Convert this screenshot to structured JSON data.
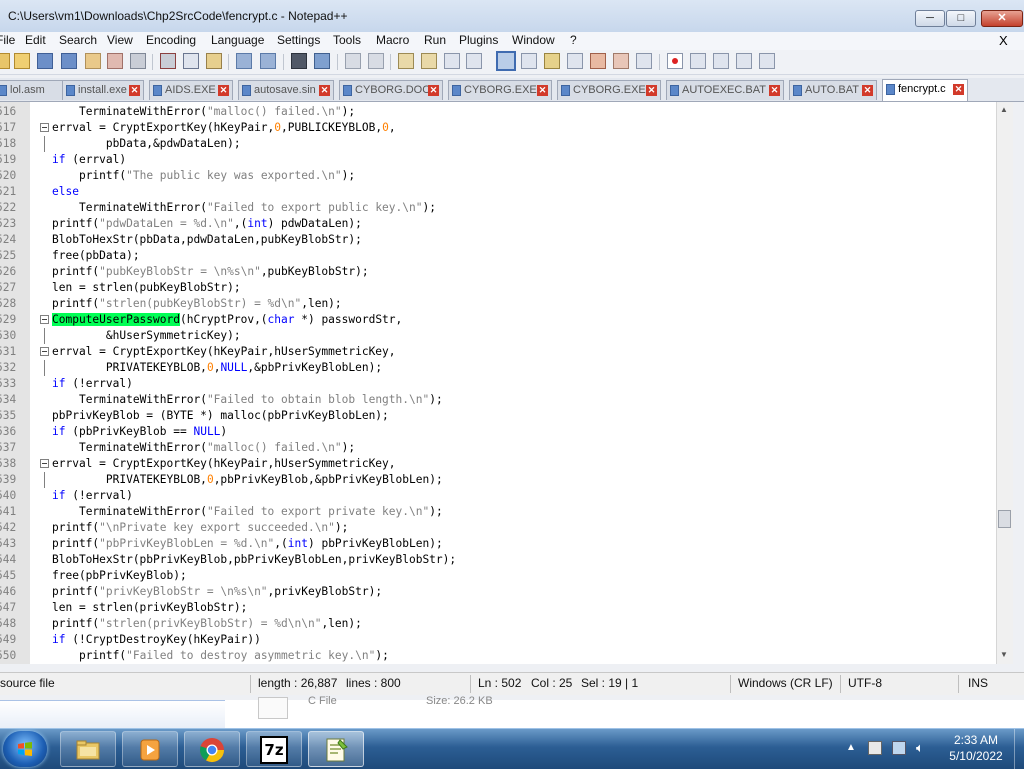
{
  "window": {
    "title": "C:\\Users\\vm1\\Downloads\\Chp2SrcCode\\fencrypt.c - Notepad++",
    "min_glyph": "─",
    "max_glyph": "□",
    "close_glyph": "✕"
  },
  "menu": {
    "items": [
      "File",
      "Edit",
      "Search",
      "View",
      "Encoding",
      "Language",
      "Settings",
      "Tools",
      "Macro",
      "Run",
      "Plugins",
      "Window",
      "?"
    ],
    "close_x": "X"
  },
  "tabs": [
    {
      "label": "lol.asm",
      "active": false
    },
    {
      "label": "install.exe",
      "active": false
    },
    {
      "label": "AIDS.EXE",
      "active": false
    },
    {
      "label": "autosave.sin",
      "active": false
    },
    {
      "label": "CYBORG.DOC",
      "active": false
    },
    {
      "label": "CYBORG.EXE",
      "active": false
    },
    {
      "label": "CYBORG.EXE",
      "active": false
    },
    {
      "label": "AUTOEXEC.BAT",
      "active": false
    },
    {
      "label": "AUTO.BAT",
      "active": false
    },
    {
      "label": "fencrypt.c",
      "active": true
    }
  ],
  "tab_close_glyph": "✕",
  "editor": {
    "lines": [
      {
        "num": "516",
        "fold": "none",
        "indent": "    ",
        "tokens": [
          [
            "TerminateWithError(",
            ""
          ],
          [
            "\"malloc() failed.\\n\"",
            "s"
          ],
          [
            ");",
            ""
          ]
        ]
      },
      {
        "num": "517",
        "fold": "open",
        "indent": "",
        "tokens": [
          [
            "errval = CryptExportKey(hKeyPair,",
            ""
          ],
          [
            "0",
            "n"
          ],
          [
            ",PUBLICKEYBLOB,",
            ""
          ],
          [
            "0",
            "n"
          ],
          [
            ",",
            ""
          ]
        ]
      },
      {
        "num": "518",
        "fold": "line",
        "indent": "        ",
        "tokens": [
          [
            "pbData,&pdwDataLen);",
            ""
          ]
        ]
      },
      {
        "num": "519",
        "fold": "none",
        "indent": "",
        "tokens": [
          [
            "if",
            "k"
          ],
          [
            " (errval)",
            ""
          ]
        ]
      },
      {
        "num": "520",
        "fold": "none",
        "indent": "    ",
        "tokens": [
          [
            "printf(",
            ""
          ],
          [
            "\"The public key was exported.\\n\"",
            "s"
          ],
          [
            ");",
            ""
          ]
        ]
      },
      {
        "num": "521",
        "fold": "none",
        "indent": "",
        "tokens": [
          [
            "else",
            "k"
          ]
        ]
      },
      {
        "num": "522",
        "fold": "none",
        "indent": "    ",
        "tokens": [
          [
            "TerminateWithError(",
            ""
          ],
          [
            "\"Failed to export public key.\\n\"",
            "s"
          ],
          [
            ");",
            ""
          ]
        ]
      },
      {
        "num": "523",
        "fold": "none",
        "indent": "",
        "tokens": [
          [
            "printf(",
            ""
          ],
          [
            "\"pdwDataLen = %d.\\n\"",
            "s"
          ],
          [
            ",(",
            ""
          ],
          [
            "int",
            "k"
          ],
          [
            ") pdwDataLen);",
            ""
          ]
        ]
      },
      {
        "num": "524",
        "fold": "none",
        "indent": "",
        "tokens": [
          [
            "BlobToHexStr(pbData,pdwDataLen,pubKeyBlobStr);",
            ""
          ]
        ]
      },
      {
        "num": "525",
        "fold": "none",
        "indent": "",
        "tokens": [
          [
            "free(pbData);",
            ""
          ]
        ]
      },
      {
        "num": "526",
        "fold": "none",
        "indent": "",
        "tokens": [
          [
            "printf(",
            ""
          ],
          [
            "\"pubKeyBlobStr = \\n%s\\n\"",
            "s"
          ],
          [
            ",pubKeyBlobStr);",
            ""
          ]
        ]
      },
      {
        "num": "527",
        "fold": "none",
        "indent": "",
        "tokens": [
          [
            "len = strlen(pubKeyBlobStr);",
            ""
          ]
        ]
      },
      {
        "num": "528",
        "fold": "none",
        "indent": "",
        "tokens": [
          [
            "printf(",
            ""
          ],
          [
            "\"strlen(pubKeyBlobStr) = %d\\n\"",
            "s"
          ],
          [
            ",len);",
            ""
          ]
        ]
      },
      {
        "num": "529",
        "fold": "open",
        "indent": "",
        "tokens": [
          [
            "ComputeUserPassword",
            "hl"
          ],
          [
            "(hCryptProv,(",
            ""
          ],
          [
            "char",
            "k"
          ],
          [
            " *) passwordStr,",
            ""
          ]
        ]
      },
      {
        "num": "530",
        "fold": "line",
        "indent": "        ",
        "tokens": [
          [
            "&hUserSymmetricKey);",
            ""
          ]
        ]
      },
      {
        "num": "531",
        "fold": "open",
        "indent": "",
        "tokens": [
          [
            "errval = CryptExportKey(hKeyPair,hUserSymmetricKey,",
            ""
          ]
        ]
      },
      {
        "num": "532",
        "fold": "line",
        "indent": "        ",
        "tokens": [
          [
            "PRIVATEKEYBLOB,",
            ""
          ],
          [
            "0",
            "n"
          ],
          [
            ",",
            ""
          ],
          [
            "NULL",
            "k"
          ],
          [
            ",&pbPrivKeyBlobLen);",
            ""
          ]
        ]
      },
      {
        "num": "533",
        "fold": "none",
        "indent": "",
        "tokens": [
          [
            "if",
            "k"
          ],
          [
            " (!errval)",
            ""
          ]
        ]
      },
      {
        "num": "534",
        "fold": "none",
        "indent": "    ",
        "tokens": [
          [
            "TerminateWithError(",
            ""
          ],
          [
            "\"Failed to obtain blob length.\\n\"",
            "s"
          ],
          [
            ");",
            ""
          ]
        ]
      },
      {
        "num": "535",
        "fold": "none",
        "indent": "",
        "tokens": [
          [
            "pbPrivKeyBlob = (BYTE *) malloc(pbPrivKeyBlobLen);",
            ""
          ]
        ]
      },
      {
        "num": "536",
        "fold": "none",
        "indent": "",
        "tokens": [
          [
            "if",
            "k"
          ],
          [
            " (pbPrivKeyBlob == ",
            ""
          ],
          [
            "NULL",
            "k"
          ],
          [
            ")",
            ""
          ]
        ]
      },
      {
        "num": "537",
        "fold": "none",
        "indent": "    ",
        "tokens": [
          [
            "TerminateWithError(",
            ""
          ],
          [
            "\"malloc() failed.\\n\"",
            "s"
          ],
          [
            ");",
            ""
          ]
        ]
      },
      {
        "num": "538",
        "fold": "open",
        "indent": "",
        "tokens": [
          [
            "errval = CryptExportKey(hKeyPair,hUserSymmetricKey,",
            ""
          ]
        ]
      },
      {
        "num": "539",
        "fold": "line",
        "indent": "        ",
        "tokens": [
          [
            "PRIVATEKEYBLOB,",
            ""
          ],
          [
            "0",
            "n"
          ],
          [
            ",pbPrivKeyBlob,&pbPrivKeyBlobLen);",
            ""
          ]
        ]
      },
      {
        "num": "540",
        "fold": "none",
        "indent": "",
        "tokens": [
          [
            "if",
            "k"
          ],
          [
            " (!errval)",
            ""
          ]
        ]
      },
      {
        "num": "541",
        "fold": "none",
        "indent": "    ",
        "tokens": [
          [
            "TerminateWithError(",
            ""
          ],
          [
            "\"Failed to export private key.\\n\"",
            "s"
          ],
          [
            ");",
            ""
          ]
        ]
      },
      {
        "num": "542",
        "fold": "none",
        "indent": "",
        "tokens": [
          [
            "printf(",
            ""
          ],
          [
            "\"\\nPrivate key export succeeded.\\n\"",
            "s"
          ],
          [
            ");",
            ""
          ]
        ]
      },
      {
        "num": "543",
        "fold": "none",
        "indent": "",
        "tokens": [
          [
            "printf(",
            ""
          ],
          [
            "\"pbPrivKeyBlobLen = %d.\\n\"",
            "s"
          ],
          [
            ",(",
            ""
          ],
          [
            "int",
            "k"
          ],
          [
            ") pbPrivKeyBlobLen);",
            ""
          ]
        ]
      },
      {
        "num": "544",
        "fold": "none",
        "indent": "",
        "tokens": [
          [
            "BlobToHexStr(pbPrivKeyBlob,pbPrivKeyBlobLen,privKeyBlobStr);",
            ""
          ]
        ]
      },
      {
        "num": "545",
        "fold": "none",
        "indent": "",
        "tokens": [
          [
            "free(pbPrivKeyBlob);",
            ""
          ]
        ]
      },
      {
        "num": "546",
        "fold": "none",
        "indent": "",
        "tokens": [
          [
            "printf(",
            ""
          ],
          [
            "\"privKeyBlobStr = \\n%s\\n\"",
            "s"
          ],
          [
            ",privKeyBlobStr);",
            ""
          ]
        ]
      },
      {
        "num": "547",
        "fold": "none",
        "indent": "",
        "tokens": [
          [
            "len = strlen(privKeyBlobStr);",
            ""
          ]
        ]
      },
      {
        "num": "548",
        "fold": "none",
        "indent": "",
        "tokens": [
          [
            "printf(",
            ""
          ],
          [
            "\"strlen(privKeyBlobStr) = %d\\n\\n\"",
            "s"
          ],
          [
            ",len);",
            ""
          ]
        ]
      },
      {
        "num": "549",
        "fold": "none",
        "indent": "",
        "tokens": [
          [
            "if",
            "k"
          ],
          [
            " (!CryptDestroyKey(hKeyPair))",
            ""
          ]
        ]
      },
      {
        "num": "550",
        "fold": "none",
        "indent": "    ",
        "tokens": [
          [
            "printf(",
            ""
          ],
          [
            "\"Failed to destroy asymmetric key.\\n\"",
            "s"
          ],
          [
            ");",
            ""
          ]
        ]
      }
    ]
  },
  "status": {
    "file_type": "source file",
    "length": "length : 26,887",
    "lines": "lines : 800",
    "ln": "Ln : 502",
    "col": "Col : 25",
    "sel": "Sel : 19 | 1",
    "eol": "Windows (CR LF)",
    "encoding": "UTF-8",
    "mode": "INS"
  },
  "background_window": {
    "col1": "C File",
    "col2": "Size: 26.2 KB"
  },
  "taskbar": {
    "time": "2:33 AM",
    "date": "5/10/2022",
    "seven_zip_label": "7z"
  },
  "colors": {
    "string": "#808080",
    "keyword": "#0000ff",
    "number": "#ff8000",
    "highlight": "#00ff55"
  }
}
